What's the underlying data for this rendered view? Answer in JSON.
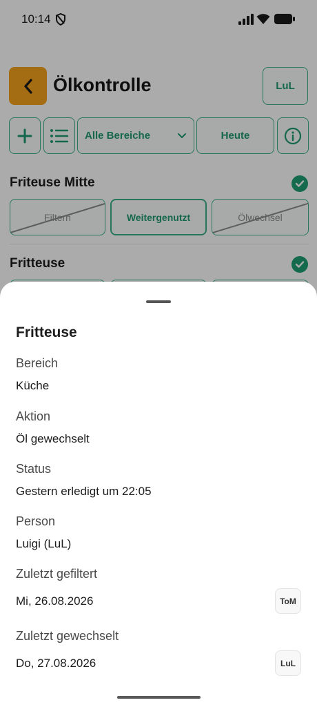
{
  "status_bar": {
    "time": "10:14"
  },
  "header": {
    "title": "Ölkontrolle",
    "user_badge": "LuL"
  },
  "toolbar": {
    "area_label": "Alle Bereiche",
    "date_label": "Heute"
  },
  "sections": [
    {
      "title": "Friteuse Mitte",
      "options": [
        {
          "label": "Filtern",
          "state": "crossed"
        },
        {
          "label": "Weitergenutzt",
          "state": "active"
        },
        {
          "label": "Ölwechsel",
          "state": "crossed"
        }
      ]
    },
    {
      "title": "Fritteuse"
    }
  ],
  "sheet": {
    "title": "Fritteuse",
    "fields": [
      {
        "label": "Bereich",
        "value": "Küche"
      },
      {
        "label": "Aktion",
        "value": "Öl gewechselt"
      },
      {
        "label": "Status",
        "value": "Gestern erledigt um 22:05"
      },
      {
        "label": "Person",
        "value": "Luigi (LuL)"
      },
      {
        "label": "Zuletzt gefiltert",
        "value": "Mi, 26.08.2026",
        "badge": "ToM"
      },
      {
        "label": "Zuletzt gewechselt",
        "value": "Do, 27.08.2026",
        "badge": "LuL"
      }
    ]
  },
  "colors": {
    "accent": "#1f9a72",
    "back_button": "#f5a21d",
    "check": "#1e9e74"
  },
  "icons": [
    "shield-icon",
    "signal-icon",
    "wifi-icon",
    "battery-icon",
    "chevron-left-icon",
    "plus-icon",
    "list-icon",
    "chevron-down-icon",
    "info-icon",
    "check-icon"
  ]
}
